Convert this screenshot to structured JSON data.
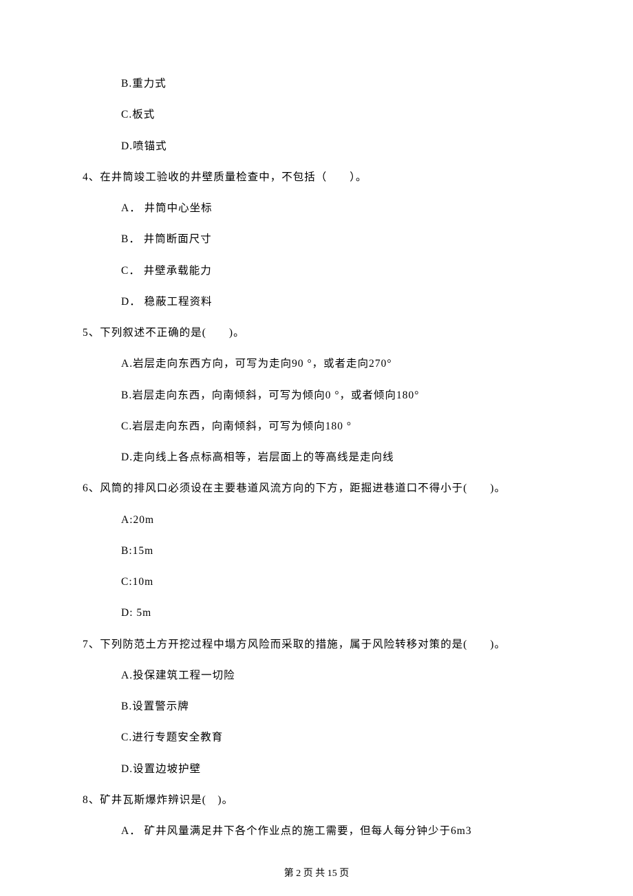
{
  "blocks": [
    {
      "type": "option",
      "text": "B.重力式"
    },
    {
      "type": "option",
      "text": "C.板式"
    },
    {
      "type": "option",
      "text": "D.喷锚式"
    },
    {
      "type": "question",
      "text": "4、在井筒竣工验收的井壁质量检查中，不包括（　　）。"
    },
    {
      "type": "option",
      "text": "A． 井筒中心坐标"
    },
    {
      "type": "option",
      "text": "B． 井筒断面尺寸"
    },
    {
      "type": "option",
      "text": "C． 井壁承载能力"
    },
    {
      "type": "option",
      "text": "D． 稳蔽工程资料"
    },
    {
      "type": "question",
      "text": "5、下列叙述不正确的是(　　)。"
    },
    {
      "type": "option",
      "text": "A.岩层走向东西方向，可写为走向90 °，或者走向270°"
    },
    {
      "type": "option",
      "text": "B.岩层走向东西，向南倾斜，可写为倾向0 °，或者倾向180°"
    },
    {
      "type": "option",
      "text": "C.岩层走向东西，向南倾斜，可写为倾向180 °"
    },
    {
      "type": "option",
      "text": "D.走向线上各点标高相等，岩层面上的等高线是走向线"
    },
    {
      "type": "question",
      "text": "6、风筒的排风口必须设在主要巷道风流方向的下方，距掘进巷道口不得小于(　　)。"
    },
    {
      "type": "option",
      "text": "A:20m"
    },
    {
      "type": "option",
      "text": "B:15m"
    },
    {
      "type": "option",
      "text": "C:10m"
    },
    {
      "type": "option",
      "text": "D: 5m"
    },
    {
      "type": "question",
      "text": "7、下列防范土方开挖过程中塌方风险而采取的措施，属于风险转移对策的是(　　)。"
    },
    {
      "type": "option",
      "text": "A.投保建筑工程一切险"
    },
    {
      "type": "option",
      "text": "B.设置警示牌"
    },
    {
      "type": "option",
      "text": "C.进行专题安全教育"
    },
    {
      "type": "option",
      "text": "D.设置边坡护壁"
    },
    {
      "type": "question",
      "text": "8、矿井瓦斯爆炸辨识是(　)。"
    },
    {
      "type": "option",
      "text": "A． 矿井风量满足井下各个作业点的施工需要，但每人每分钟少于6m3"
    }
  ],
  "footer": "第 2 页 共 15 页"
}
